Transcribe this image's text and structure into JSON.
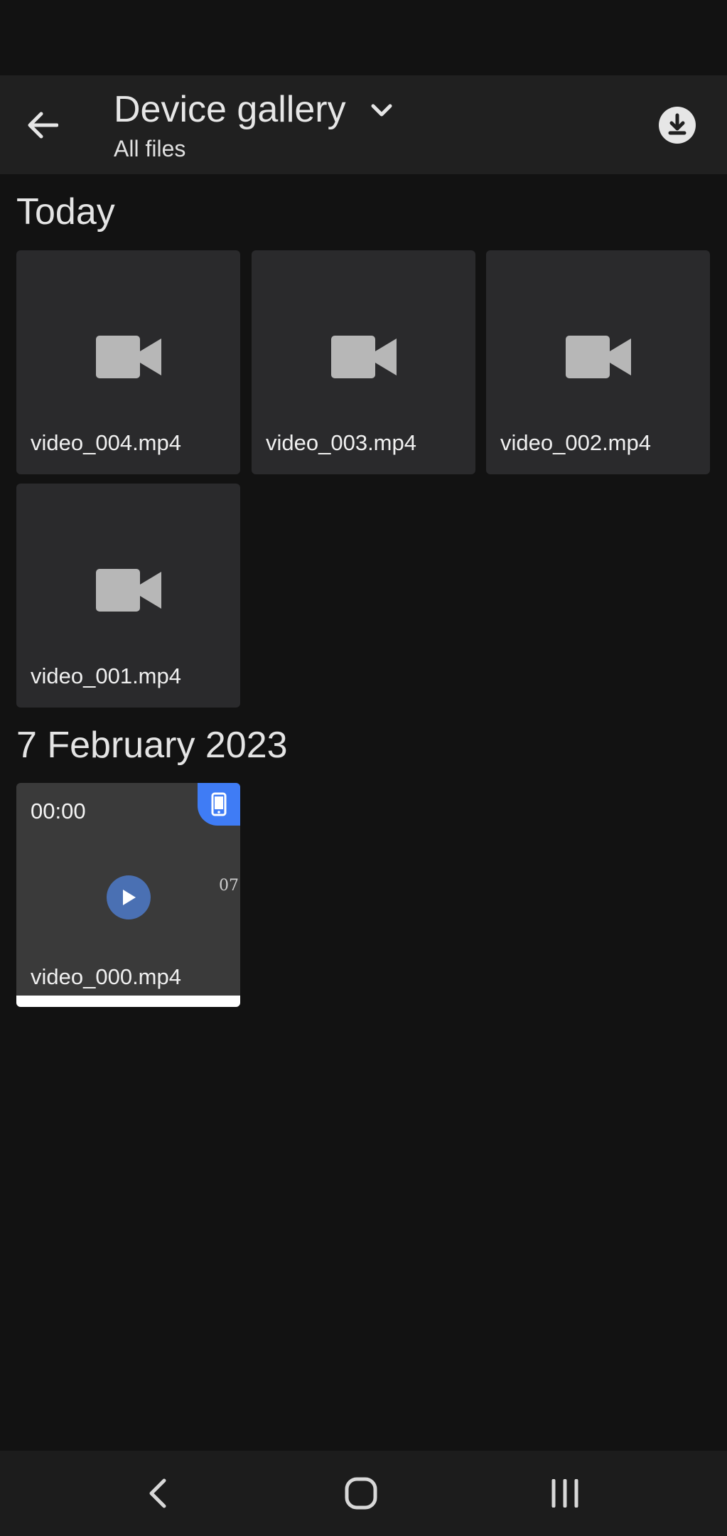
{
  "header": {
    "title": "Device gallery",
    "subtitle": "All files"
  },
  "sections": [
    {
      "title": "Today",
      "items": [
        {
          "name": "video_004.mp4"
        },
        {
          "name": "video_003.mp4"
        },
        {
          "name": "video_002.mp4"
        },
        {
          "name": "video_001.mp4"
        }
      ]
    },
    {
      "title": "7 February 2023",
      "items": [
        {
          "name": "video_000.mp4",
          "duration": "00:00",
          "overlay_text": "07"
        }
      ]
    }
  ],
  "colors": {
    "background": "#121212",
    "app_bar": "#202020",
    "tile": "#2a2a2c",
    "accent": "#3f7cf5",
    "play": "#4a70b3"
  },
  "icons": {
    "back": "arrow-left-icon",
    "dropdown": "chevron-down-icon",
    "download": "download-icon",
    "video": "video-camera-icon",
    "play": "play-icon",
    "device": "phone-icon"
  }
}
